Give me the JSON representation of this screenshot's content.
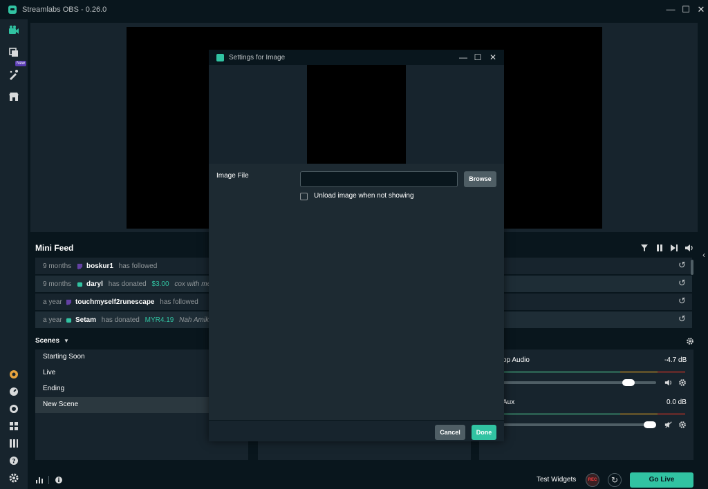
{
  "app": {
    "title": "Streamlabs OBS - 0.26.0",
    "minimize": "—",
    "maximize": "☐",
    "close": "✕"
  },
  "nav": {
    "new_badge": "New"
  },
  "minifeed": {
    "title": "Mini Feed",
    "items": [
      {
        "time": "9 months",
        "user": "boskur1",
        "action": "has followed",
        "amount": "",
        "message": ""
      },
      {
        "time": "9 months",
        "user": "daryl",
        "action": "has donated",
        "amount": "$3.00",
        "message": "cox with me d"
      },
      {
        "time": "a year",
        "user": "touchmyself2runescape",
        "action": "has followed",
        "amount": "",
        "message": ""
      },
      {
        "time": "a year",
        "user": "Setam",
        "action": "has donated",
        "amount": "MYR4.19",
        "message": "Nah Amik"
      }
    ]
  },
  "scenes": {
    "title": "Scenes",
    "items": [
      "Starting Soon",
      "Live",
      "Ending",
      "New Scene"
    ],
    "active_index": 3
  },
  "mixer": {
    "items": [
      {
        "name": "op Audio",
        "db": "-4.7 dB",
        "level": 0.86
      },
      {
        "name": "Aux",
        "db": "0.0 dB",
        "level": 1.0
      }
    ]
  },
  "bottom": {
    "test_widgets": "Test Widgets",
    "rec": "REC",
    "go_live": "Go Live"
  },
  "modal": {
    "title": "Settings for Image",
    "image_file_label": "Image File",
    "image_file_value": "",
    "browse": "Browse",
    "unload_label": "Unload image when not showing",
    "cancel": "Cancel",
    "done": "Done"
  },
  "colors": {
    "accent": "#31c3a2",
    "rec": "#fc3e3f",
    "badge": "#5b3db4"
  }
}
